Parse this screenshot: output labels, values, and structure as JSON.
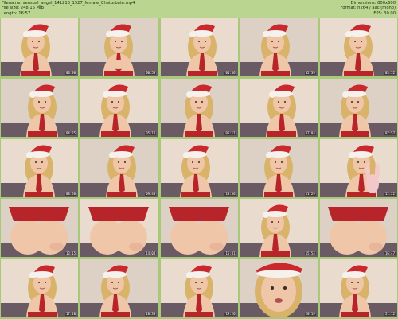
{
  "header": {
    "left_lines": [
      "Filename: sensual_angel_141216_1527_female_Chaturbate.mp4",
      "File size: 248.16 MiB",
      "Length: 16:57"
    ],
    "right_lines": [
      "Dimensions: 800x600",
      "Format: h264 / aac (mono)",
      "FPS: 30.00"
    ]
  },
  "thumbnails": [
    {
      "time": "00:00",
      "scene": "close"
    },
    {
      "time": "00:53",
      "scene": "hands"
    },
    {
      "time": "01:46",
      "scene": "close"
    },
    {
      "time": "02:39",
      "scene": "close"
    },
    {
      "time": "03:32",
      "scene": "close"
    },
    {
      "time": "04:25",
      "scene": "close"
    },
    {
      "time": "05:18",
      "scene": "close"
    },
    {
      "time": "06:11",
      "scene": "close"
    },
    {
      "time": "07:04",
      "scene": "close"
    },
    {
      "time": "07:57",
      "scene": "close"
    },
    {
      "time": "08:50",
      "scene": "close"
    },
    {
      "time": "09:43",
      "scene": "close"
    },
    {
      "time": "10:36",
      "scene": "close"
    },
    {
      "time": "11:29",
      "scene": "close"
    },
    {
      "time": "12:22",
      "scene": "plush"
    },
    {
      "time": "13:15",
      "scene": "rear"
    },
    {
      "time": "14:08",
      "scene": "rear"
    },
    {
      "time": "15:01",
      "scene": "rear"
    },
    {
      "time": "15:54",
      "scene": "close"
    },
    {
      "time": "16:47",
      "scene": "rear"
    },
    {
      "time": "17:40",
      "scene": "close"
    },
    {
      "time": "18:33",
      "scene": "close"
    },
    {
      "time": "19:26",
      "scene": "close"
    },
    {
      "time": "20:19",
      "scene": "closeup"
    },
    {
      "time": "21:12",
      "scene": "close"
    }
  ],
  "colors": {
    "background": "#a8c87a",
    "header": "#b9d58f",
    "hat_red": "#c9282c",
    "hat_white": "#f5f2ee",
    "hair": "#d9b36a",
    "skin": "#efc6a8",
    "tartan": "#b7252b"
  }
}
